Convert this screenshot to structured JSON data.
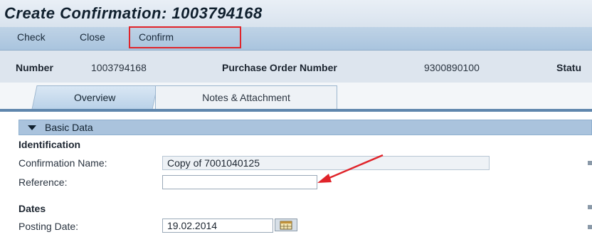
{
  "window": {
    "title": "Create Confirmation: 1003794168"
  },
  "toolbar": {
    "check_label": "Check",
    "close_label": "Close",
    "confirm_label": "Confirm"
  },
  "header": {
    "number_label": "Number",
    "number_value": "1003794168",
    "po_label": "Purchase Order Number",
    "po_value": "9300890100",
    "status_label": "Statu"
  },
  "tabs": [
    {
      "label": "Overview",
      "active": true
    },
    {
      "label": "Notes & Attachment",
      "active": false
    }
  ],
  "section": {
    "title": "Basic Data",
    "identification": {
      "heading": "Identification",
      "confirmation_name_label": "Confirmation Name:",
      "confirmation_name_value": "Copy of 7001040125",
      "reference_label": "Reference:",
      "reference_value": ""
    },
    "dates": {
      "heading": "Dates",
      "posting_date_label": "Posting Date:",
      "posting_date_value": "19.02.2014"
    }
  },
  "colors": {
    "highlight": "#e0242a",
    "accent": "#5f86ad"
  },
  "icons": {
    "calendar": "calendar-icon",
    "expand": "triangle-down-icon",
    "annotation": "red-arrow-icon"
  }
}
